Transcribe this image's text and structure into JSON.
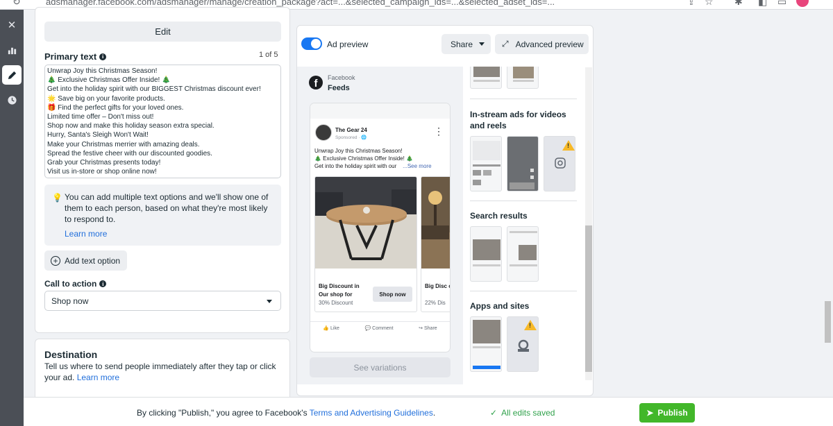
{
  "browser": {
    "url": "adsmanager.facebook.com/adsmanager/manage/creation_package?act=...&selected_campaign_ids=...&selected_adset_ids=..."
  },
  "left": {
    "edit_label": "Edit",
    "primary_text_label": "Primary text",
    "primary_text_count": "1 of 5",
    "primary_text_lines": [
      "Unwrap Joy this Christmas Season!",
      "🎄 Exclusive Christmas Offer Inside! 🎄",
      "Get into the holiday spirit with our BIGGEST Christmas discount ever!",
      "🌟 Save big on your favorite products.",
      "🎁 Find the perfect gifts for your loved ones.",
      "Limited time offer – Don't miss out!",
      "Shop now and make this holiday season extra special.",
      "Hurry, Santa's Sleigh Won't Wait!",
      "Make your Christmas merrier with amazing deals.",
      "Spread the festive cheer with our discounted goodies.",
      "Grab your Christmas presents today!",
      "Visit us in-store or shop online now!"
    ],
    "tip_text": "You can add multiple text options and we'll show one of them to each person, based on what they're most likely to respond to.",
    "tip_link": "Learn more",
    "add_text_option": "Add text option",
    "cta_label": "Call to action",
    "cta_value": "Shop now",
    "destination_title": "Destination",
    "destination_desc": "Tell us where to send people immediately after they tap or click your ad.",
    "destination_link": "Learn more"
  },
  "preview": {
    "toggle_label": "Ad preview",
    "share_label": "Share",
    "advanced_label": "Advanced preview",
    "platform": "Facebook",
    "placement": "Feeds",
    "post": {
      "page_name": "The Gear 24",
      "sponsored": "Sponsored · 🌐",
      "text_lines": [
        "Unwrap Joy this Christmas Season!",
        "🎄 Exclusive Christmas Offer Inside! 🎄",
        "Get into the holiday spirit with our"
      ],
      "see_more": "...See more",
      "cards": [
        {
          "title": "Big Discount in Our shop for",
          "subtitle": "30% Discount",
          "cta": "Shop now"
        },
        {
          "title": "Big Disc out sho",
          "subtitle": "22% Dis",
          "cta": ""
        }
      ],
      "actions": [
        "Like",
        "Comment",
        "Share"
      ]
    },
    "see_variations": "See variations",
    "sections": {
      "instream": "In-stream ads for videos and reels",
      "search": "Search results",
      "apps": "Apps and sites"
    }
  },
  "footer": {
    "agree_prefix": "By clicking \"Publish,\" you agree to Facebook's",
    "agree_link": "Terms and Advertising Guidelines",
    "agree_suffix": ".",
    "saved": "All edits saved",
    "publish": "Publish"
  }
}
